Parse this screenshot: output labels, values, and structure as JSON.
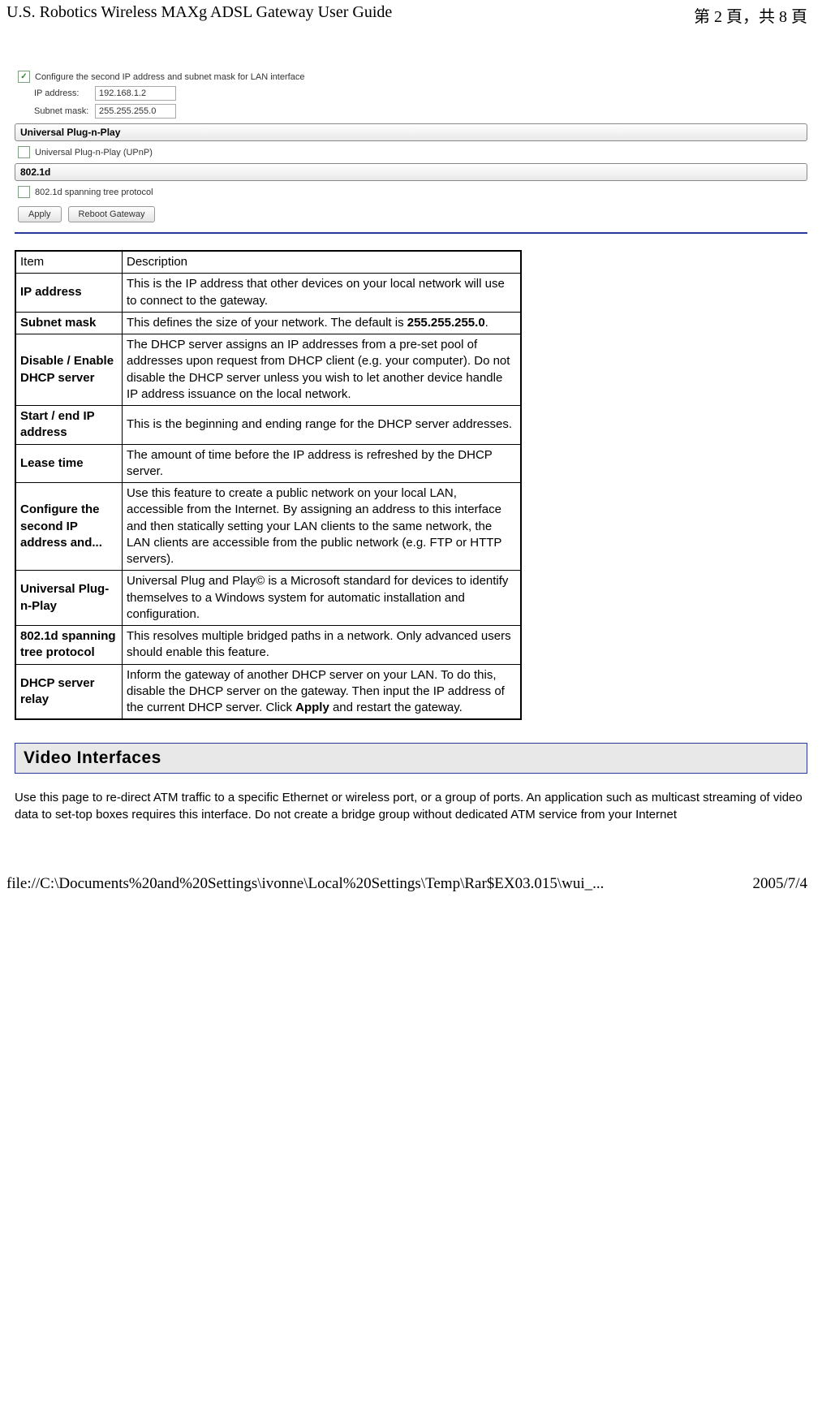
{
  "header": {
    "title": "U.S. Robotics Wireless MAXg ADSL Gateway User Guide",
    "page_info": "第 2 頁，共 8 頁"
  },
  "screenshot": {
    "configure_second_ip_label": "Configure the second IP address and subnet mask for LAN interface",
    "ip_address_label": "IP address:",
    "ip_address_value": "192.168.1.2",
    "subnet_mask_label": "Subnet mask:",
    "subnet_mask_value": "255.255.255.0",
    "upnp_bar": "Universal Plug-n-Play",
    "upnp_checkbox_label": "Universal Plug-n-Play (UPnP)",
    "d8021_bar": "802.1d",
    "d8021_checkbox_label": "802.1d spanning tree protocol",
    "apply_btn": "Apply",
    "reboot_btn": "Reboot Gateway"
  },
  "table_head": {
    "item": "Item",
    "desc": "Description"
  },
  "rows": [
    {
      "item": "IP address",
      "desc": "This is the IP address that other devices on your local network will use to connect to the gateway."
    },
    {
      "item": "Subnet mask",
      "desc": "This defines the size of your network. The default is <b>255.255.255.0</b>."
    },
    {
      "item": "Disable / Enable DHCP server",
      "desc": "The DHCP server assigns an IP addresses from a pre-set pool of addresses upon request from DHCP client (e.g. your computer). Do not disable the DHCP server unless you wish to let another device handle IP address issuance on the local network."
    },
    {
      "item": "Start / end IP address",
      "desc": "This is the beginning and ending range for the DHCP server addresses."
    },
    {
      "item": "Lease time",
      "desc": "The amount of time before the IP address is refreshed by the DHCP server."
    },
    {
      "item": "Configure the second IP address and...",
      "desc": "Use this feature to create a public network on your local LAN, accessible from the Internet. By assigning an address to this interface and then statically setting your LAN clients to the same network, the LAN clients are accessible from the public network (e.g. FTP or HTTP servers)."
    },
    {
      "item": "Universal Plug-n-Play",
      "desc": "Universal Plug and Play© is a Microsoft standard for devices to identify themselves to a Windows system for automatic installation and configuration."
    },
    {
      "item": "802.1d spanning tree protocol",
      "desc": "This resolves multiple bridged paths in a network. Only advanced users should enable this feature."
    },
    {
      "item": "DHCP server relay",
      "desc": "Inform the gateway of another DHCP server on your LAN. To do this, disable the DHCP server on the gateway. Then input the IP address of the current DHCP server. Click <b>Apply</b> and restart the gateway."
    }
  ],
  "video_heading": "Video Interfaces",
  "video_paragraph": "Use this page to re-direct ATM traffic to a specific Ethernet or wireless port, or a group of ports. An application such as multicast streaming of video data to set-top boxes requires this interface. Do not create a bridge group without dedicated ATM service from your Internet",
  "footer": {
    "path": "file://C:\\Documents%20and%20Settings\\ivonne\\Local%20Settings\\Temp\\Rar$EX03.015\\wui_...",
    "date": "2005/7/4"
  }
}
